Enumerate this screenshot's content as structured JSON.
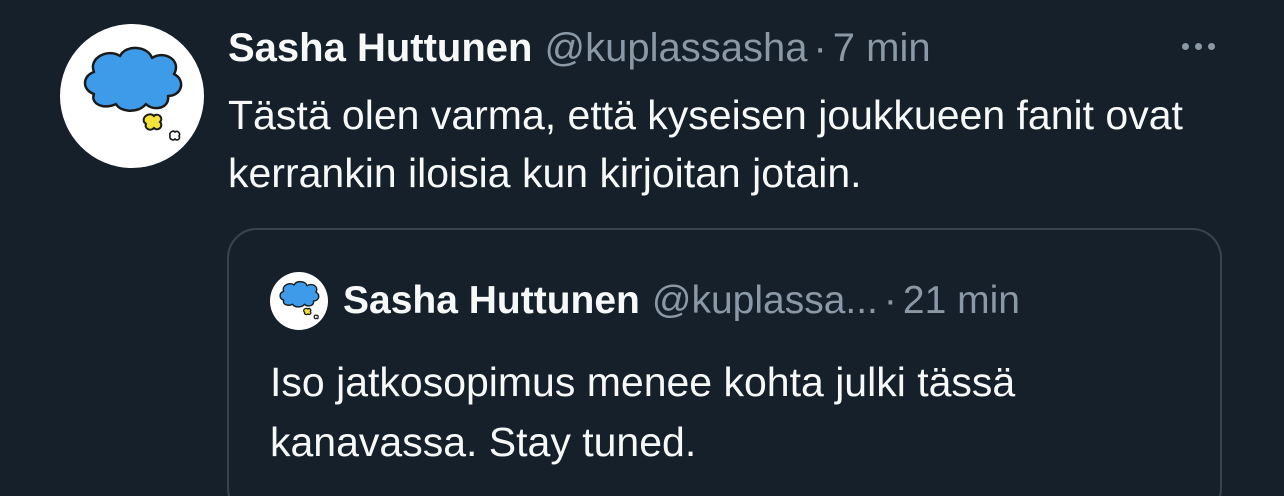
{
  "tweet": {
    "display_name": "Sasha Huttunen",
    "handle": "@kuplassasha",
    "separator": "·",
    "time": "7 min",
    "text": "Tästä olen varma, että kyseisen joukkueen fanit ovat kerrankin iloisia kun kirjoitan jotain.",
    "avatar_icon": "cloud-avatar-icon",
    "more_icon": "more-options-icon"
  },
  "quoted_tweet": {
    "display_name": "Sasha Huttunen",
    "handle": "@kuplassa...",
    "separator": "·",
    "time": "21 min",
    "text": "Iso jatkosopimus menee kohta julki tässä kanavassa. Stay tuned.",
    "avatar_icon": "cloud-avatar-icon"
  },
  "colors": {
    "background": "#15202b",
    "text_primary": "#f7f9f9",
    "text_secondary": "#8b98a5",
    "border": "#38444d",
    "cloud_blue": "#3d9be9",
    "accent_yellow": "#f2e23a"
  }
}
